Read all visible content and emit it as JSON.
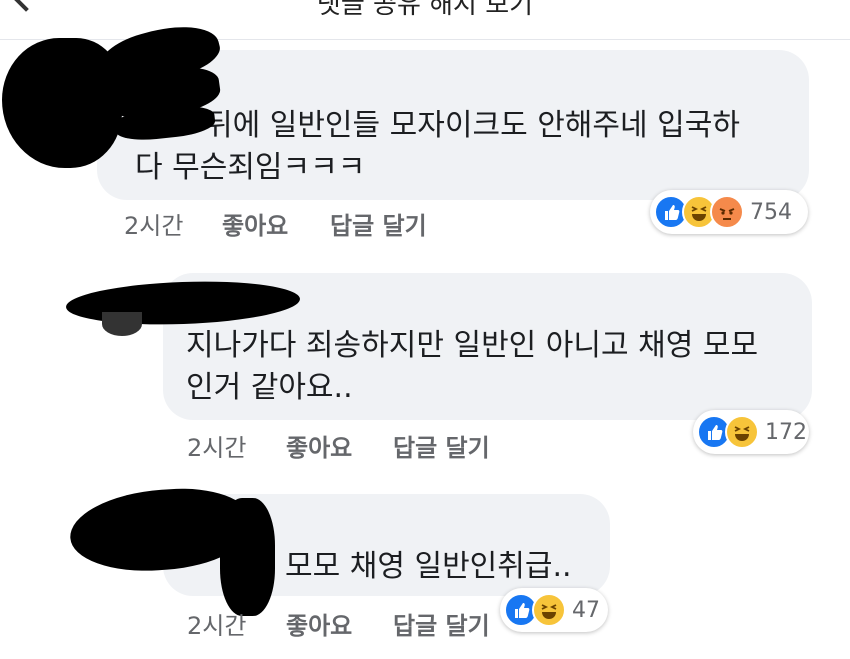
{
  "header": {
    "title": "댓글 공유 해시 보기"
  },
  "colors": {
    "bubble": "#f0f2f5",
    "like_blue": "#1877f2",
    "haha_yellow": "#f7c43a",
    "angry_orange": "#f58a4b",
    "meta_gray": "#65676b"
  },
  "comments": [
    {
      "text_line1": "뒤에 일반인들 모자이크도 안해주네 입국하",
      "text_line2": "다 무슨죄임ㅋㅋㅋ",
      "time": "2시간",
      "like_label": "좋아요",
      "reply_label": "답글 달기",
      "reaction_icons": [
        "like-icon",
        "haha-icon",
        "angry-icon"
      ],
      "reaction_count": "754"
    },
    {
      "text_line1": "지나가다 죄송하지만 일반인 아니고 채영 모모",
      "text_line2": "인거 같아요..",
      "time": "2시간",
      "like_label": "좋아요",
      "reply_label": "답글 달기",
      "reaction_icons": [
        "like-icon",
        "haha-icon"
      ],
      "reaction_count": "172"
    },
    {
      "text_line1": "모모 채영 일반인취급..",
      "time": "2시간",
      "like_label": "좋아요",
      "reply_label": "답글 달기",
      "reaction_icons": [
        "like-icon",
        "haha-icon"
      ],
      "reaction_count": "47"
    }
  ]
}
